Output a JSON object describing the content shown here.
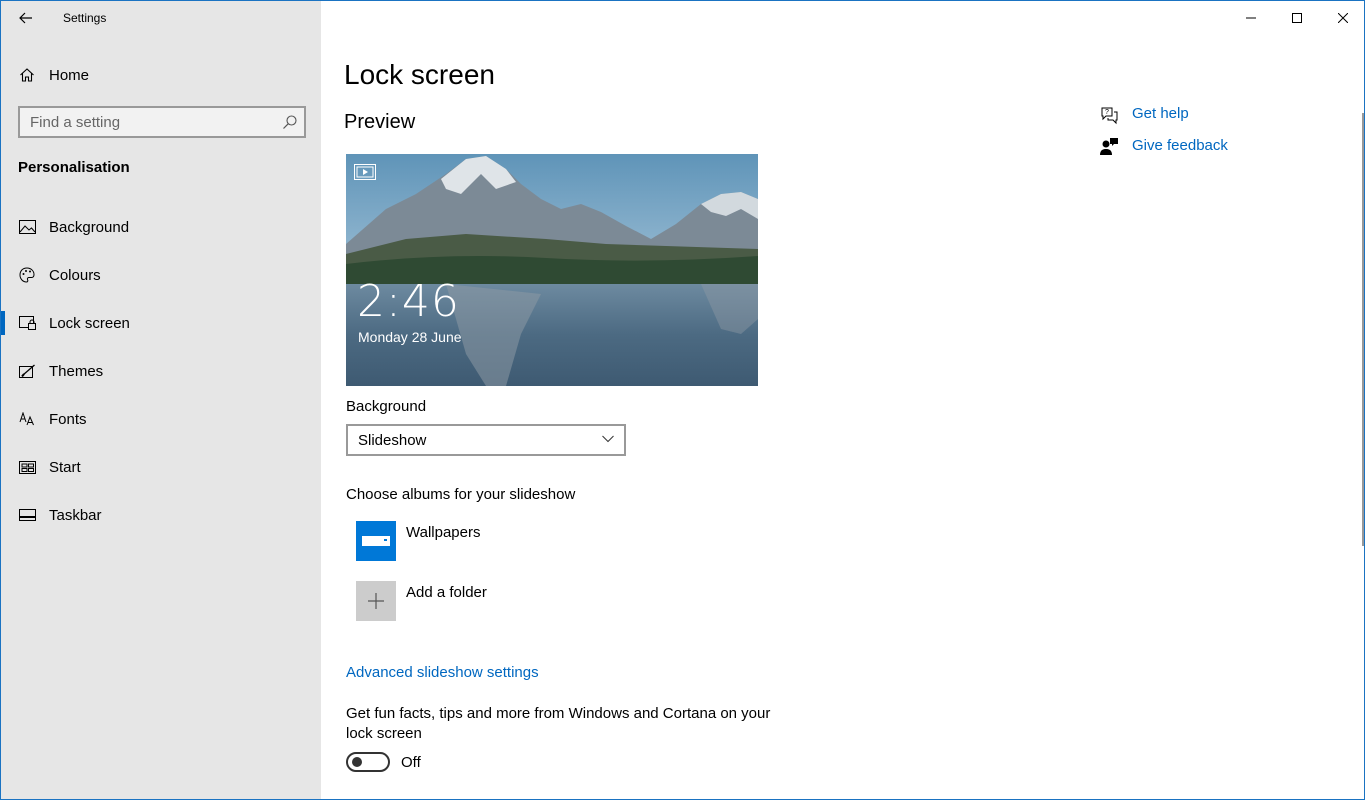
{
  "window": {
    "title": "Settings"
  },
  "sidebar": {
    "home_label": "Home",
    "search_placeholder": "Find a setting",
    "section_title": "Personalisation",
    "items": [
      {
        "label": "Background",
        "icon": "image-icon"
      },
      {
        "label": "Colours",
        "icon": "palette-icon"
      },
      {
        "label": "Lock screen",
        "icon": "lock-screen-icon",
        "active": true
      },
      {
        "label": "Themes",
        "icon": "themes-icon"
      },
      {
        "label": "Fonts",
        "icon": "fonts-icon"
      },
      {
        "label": "Start",
        "icon": "start-icon"
      },
      {
        "label": "Taskbar",
        "icon": "taskbar-icon"
      }
    ]
  },
  "main": {
    "page_title": "Lock screen",
    "preview_title": "Preview",
    "preview": {
      "time": "2:46",
      "date": "Monday 28 June"
    },
    "background_label": "Background",
    "background_value": "Slideshow",
    "albums_label": "Choose albums for your slideshow",
    "albums": [
      {
        "label": "Wallpapers",
        "icon": "folder-icon"
      },
      {
        "label": "Add a folder",
        "icon": "plus-icon"
      }
    ],
    "advanced_link": "Advanced slideshow settings",
    "fun_facts_label": "Get fun facts, tips and more from Windows and Cortana on your lock screen",
    "fun_facts_toggle": "Off"
  },
  "help": {
    "get_help": "Get help",
    "give_feedback": "Give feedback"
  },
  "colors": {
    "accent": "#0067c0",
    "sidebar_bg": "#e6e6e6",
    "folder_tile": "#0078d7"
  }
}
